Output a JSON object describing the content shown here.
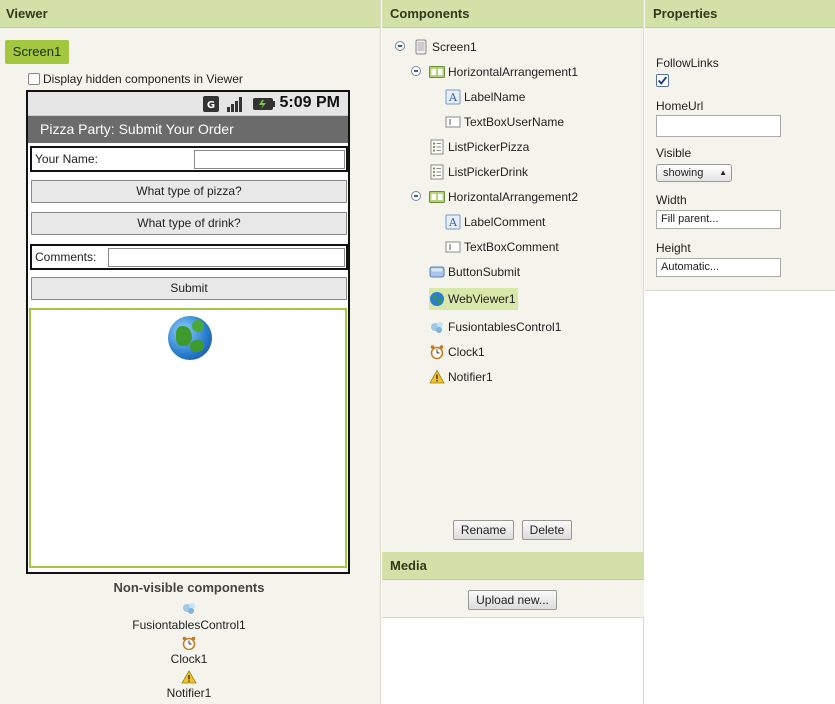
{
  "viewer": {
    "title": "Viewer",
    "screen_button": "Screen1",
    "hidden_components_label": "Display hidden components in Viewer",
    "phone": {
      "time": "5:09 PM",
      "app_title": "Pizza Party: Submit Your Order",
      "name_label": "Your Name:",
      "pizza_button": "What type of pizza?",
      "drink_button": "What type of drink?",
      "comments_label": "Comments:",
      "submit_button": "Submit"
    },
    "nonvisible": {
      "title": "Non-visible components",
      "items": [
        "FusiontablesControl1",
        "Clock1",
        "Notifier1"
      ]
    }
  },
  "components": {
    "title": "Components",
    "tree": [
      {
        "label": "Screen1",
        "icon": "screen-icon"
      },
      {
        "label": "HorizontalArrangement1",
        "icon": "arrangement-icon"
      },
      {
        "label": "LabelName",
        "icon": "label-icon"
      },
      {
        "label": "TextBoxUserName",
        "icon": "textbox-icon"
      },
      {
        "label": "ListPickerPizza",
        "icon": "listpicker-icon"
      },
      {
        "label": "ListPickerDrink",
        "icon": "listpicker-icon"
      },
      {
        "label": "HorizontalArrangement2",
        "icon": "arrangement-icon"
      },
      {
        "label": "LabelComment",
        "icon": "label-icon"
      },
      {
        "label": "TextBoxComment",
        "icon": "textbox-icon"
      },
      {
        "label": "ButtonSubmit",
        "icon": "button-icon"
      },
      {
        "label": "WebViewer1",
        "icon": "webviewer-icon"
      },
      {
        "label": "FusiontablesControl1",
        "icon": "fusiontables-icon"
      },
      {
        "label": "Clock1",
        "icon": "clock-icon"
      },
      {
        "label": "Notifier1",
        "icon": "notifier-icon"
      }
    ],
    "selected": "WebViewer1",
    "rename_button": "Rename",
    "delete_button": "Delete"
  },
  "media": {
    "title": "Media",
    "upload_button": "Upload new..."
  },
  "properties": {
    "title": "Properties",
    "follow_links_label": "FollowLinks",
    "follow_links_checked": true,
    "home_url_label": "HomeUrl",
    "home_url_value": "",
    "visible_label": "Visible",
    "visible_value": "showing",
    "width_label": "Width",
    "width_value": "Fill parent...",
    "height_label": "Height",
    "height_value": "Automatic..."
  },
  "colors": {
    "header_bg": "#d3e1a8",
    "accent_green": "#a3c83f",
    "panel_bg": "#f4f4ec"
  }
}
